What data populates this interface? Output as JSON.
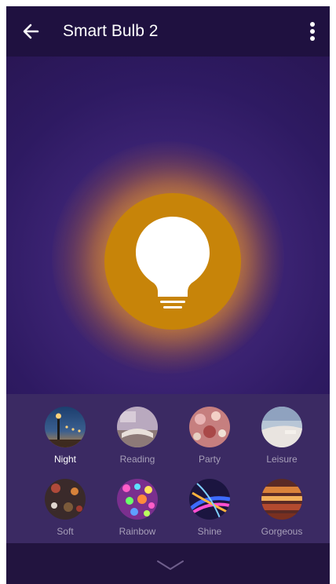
{
  "header": {
    "title": "Smart Bulb 2"
  },
  "modes": [
    {
      "label": "Night",
      "active": true
    },
    {
      "label": "Reading",
      "active": false
    },
    {
      "label": "Party",
      "active": false
    },
    {
      "label": "Leisure",
      "active": false
    },
    {
      "label": "Soft",
      "active": false
    },
    {
      "label": "Rainbow",
      "active": false
    },
    {
      "label": "Shine",
      "active": false
    },
    {
      "label": "Gorgeous",
      "active": false
    }
  ],
  "colors": {
    "background": "#2a1752",
    "bulb": "#c78409",
    "modes_panel": "#3b2a63"
  },
  "icons": {
    "back": "back-arrow-icon",
    "menu": "more-vertical-icon",
    "bulb": "lightbulb-icon",
    "expand": "chevron-down-icon"
  }
}
